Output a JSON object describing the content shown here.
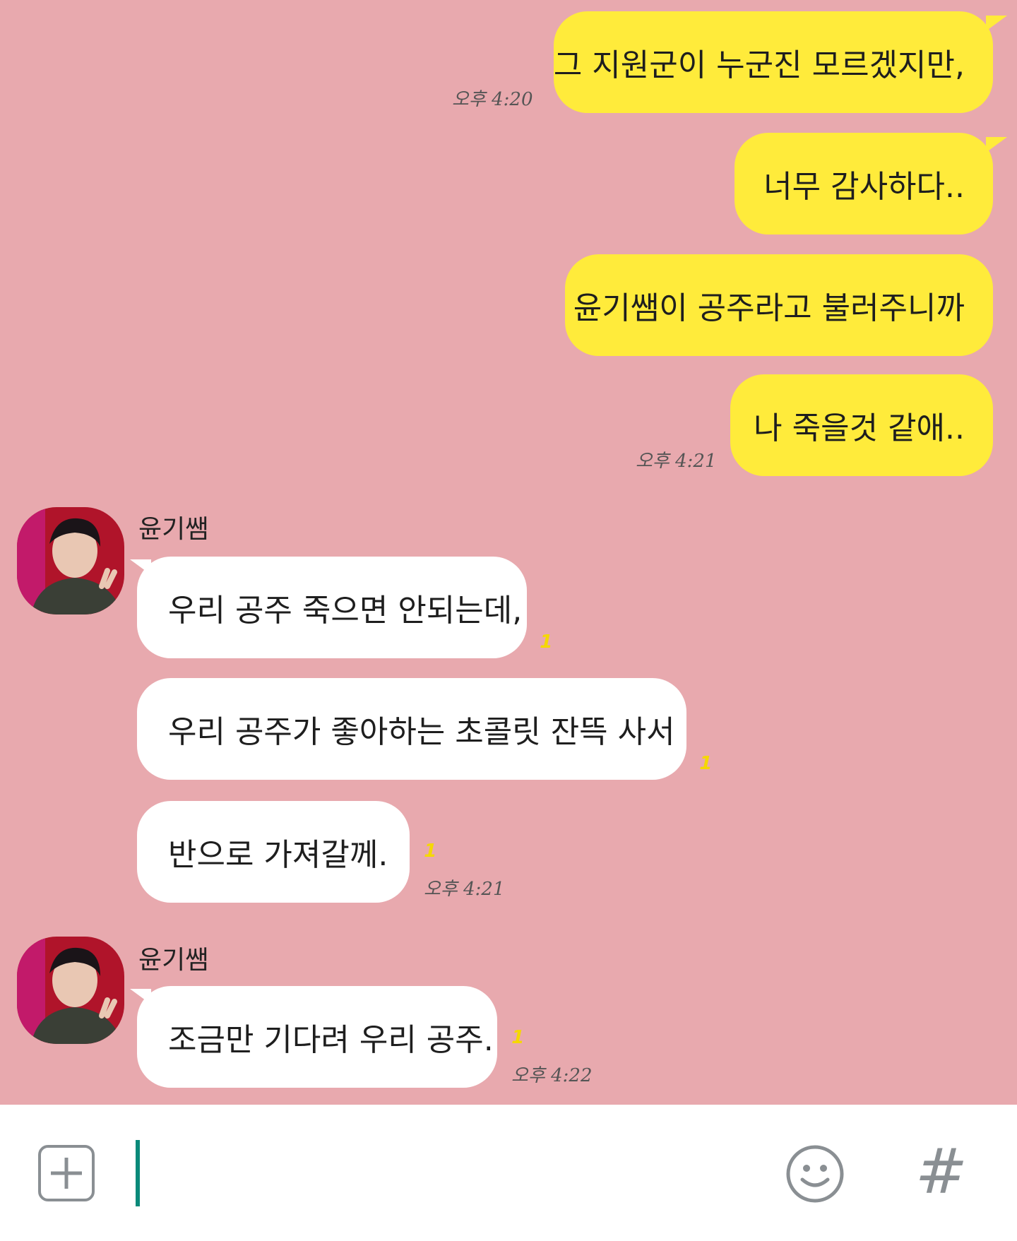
{
  "conversation": {
    "messages_sent": [
      {
        "text": "그 지원군이 누군진 모르겠지만,"
      },
      {
        "text": "너무 감사하다.."
      },
      {
        "text": "윤기쌤이 공주라고 불러주니까"
      },
      {
        "text": "나 죽을것 같애.."
      }
    ],
    "sent_times": [
      "오후 4:20",
      "오후 4:21"
    ],
    "group1": {
      "sender": "윤기쌤",
      "messages": [
        {
          "text": "우리 공주 죽으면 안되는데,"
        },
        {
          "text": "우리 공주가 좋아하는 초콜릿 잔뜩 사서"
        },
        {
          "text": "반으로 가져갈께."
        }
      ],
      "time": "오후 4:21"
    },
    "group2": {
      "sender": "윤기쌤",
      "messages": [
        {
          "text": "조금만 기다려 우리 공주."
        }
      ],
      "time": "오후 4:22"
    },
    "unread_mark": "1"
  },
  "input_bar": {
    "plus_icon": "plus-square-icon",
    "emoji_icon": "smiley-icon",
    "hash_icon": "hash-icon",
    "hash_label": "#"
  },
  "colors": {
    "background": "#e8a9ae",
    "sent_bubble": "#ffeb3b",
    "received_bubble": "#ffffff",
    "cursor": "#0a8a7a"
  }
}
